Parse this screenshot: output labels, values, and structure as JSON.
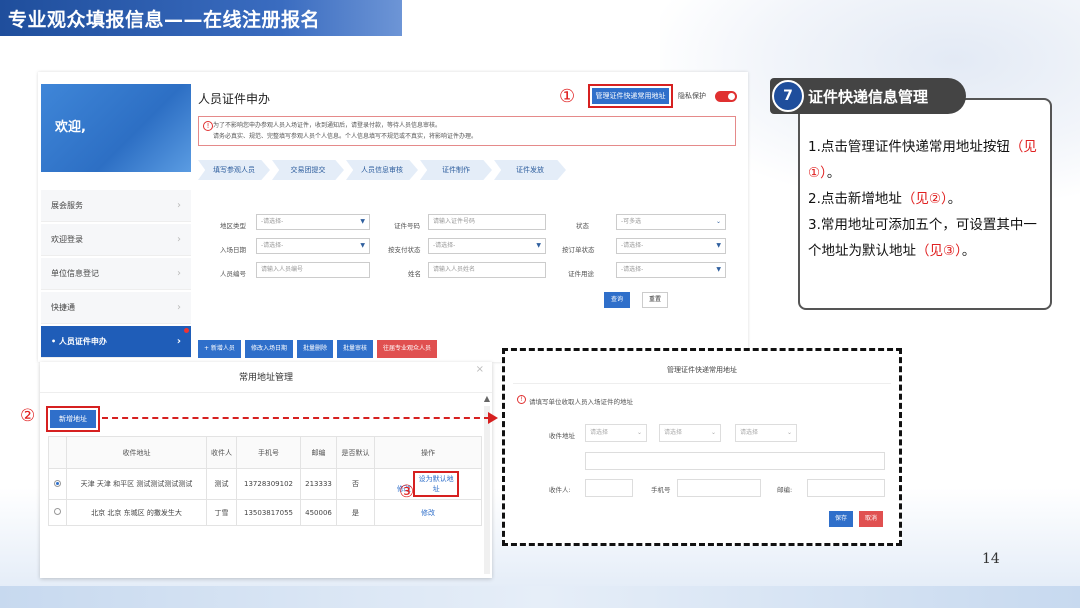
{
  "slide": {
    "title": "专业观众填报信息——在线注册报名",
    "page_number": "14"
  },
  "app": {
    "welcome": "欢迎,",
    "page_title": "人员证件申办",
    "manage_button": "管理证件快递常用地址",
    "privacy_label": "隐私保护",
    "privacy_on": true,
    "notice_line1": "为了不影响您申办参观人员入场证件，收到通知后，请登录付款，等待人员信息审核。",
    "notice_line2": "请务必真实、规范、完整填写参观人员个人信息。个人信息填写不规范或不真实，将影响证件办理。",
    "menu": [
      {
        "label": "展会服务",
        "active": false
      },
      {
        "label": "欢迎登录",
        "active": false
      },
      {
        "label": "单位信息登记",
        "active": false
      },
      {
        "label": "快捷通",
        "active": false
      },
      {
        "label": "人员证件申办",
        "active": true
      }
    ],
    "steps": [
      "填写参观人员",
      "交易团提交",
      "人员信息审核",
      "证件制作",
      "证件发放"
    ],
    "filters": {
      "region_type_label": "地区类型",
      "region_type_value": "-请选择-",
      "cert_no_label": "证件号码",
      "cert_no_placeholder": "请输入证件号码",
      "status_label": "状态",
      "status_value": "-可多选",
      "entry_date_label": "入场日期",
      "entry_date_value": "-请选择-",
      "pay_status_label": "按支付状态",
      "pay_status_value": "-请选择-",
      "order_status_label": "按订单状态",
      "order_status_value": "-请选择-",
      "person_no_label": "人员编号",
      "person_no_placeholder": "请输入人员编号",
      "name_label": "姓名",
      "name_placeholder": "请输入人员姓名",
      "cert_use_label": "证件用途",
      "cert_use_value": "-请选择-"
    },
    "query_button": "查询",
    "reset_button": "重置",
    "actions": [
      "+ 新增人员",
      "修改入场日期",
      "批量删除",
      "批量审核"
    ],
    "action_red": "往届专业观众人员"
  },
  "addr_modal": {
    "title": "常用地址管理",
    "add_button": "新增地址",
    "headers": [
      "收件地址",
      "收件人",
      "手机号",
      "邮编",
      "是否默认",
      "操作"
    ],
    "rows": [
      {
        "selected": true,
        "address": "天津 天津 和平区 测试测试测试测试",
        "recipient": "测试",
        "phone": "13728309102",
        "zip": "213333",
        "is_default": "否",
        "edit": "修改",
        "set_default": "设为默认地址"
      },
      {
        "selected": false,
        "address": "北京 北京 东城区 的撒发生大",
        "recipient": "丁雪",
        "phone": "13503817055",
        "zip": "450006",
        "is_default": "是",
        "edit": "修改",
        "set_default": ""
      }
    ]
  },
  "exp_modal": {
    "title": "管理证件快递常用地址",
    "note": "请填写单位收取人员入场证件的地址",
    "address_label": "收件地址",
    "select1": "请选择",
    "select2": "请选择",
    "select3": "请选择",
    "recipient_label": "收件人:",
    "phone_label": "手机号",
    "zip_label": "邮编:",
    "save_button": "保存",
    "cancel_button": "取消"
  },
  "markers": {
    "m1": "①",
    "m2": "②",
    "m3": "③"
  },
  "instructions": {
    "step_number": "7",
    "title": "证件快递信息管理",
    "line1": "1.点击管理证件快递常用地址按钮",
    "line1_ref": "（见①）",
    "line1_end": "。",
    "line2": "2.点击新增地址",
    "line2_ref": "（见②）",
    "line2_end": "。",
    "line3": "3.常用地址可添加五个，可设置其中一个地址为默认地址",
    "line3_ref": "（见③）",
    "line3_end": "。"
  },
  "colors": {
    "brand_blue": "#2f6fca",
    "highlight_red": "#d62020",
    "title_blue": "#1f4e9c"
  }
}
